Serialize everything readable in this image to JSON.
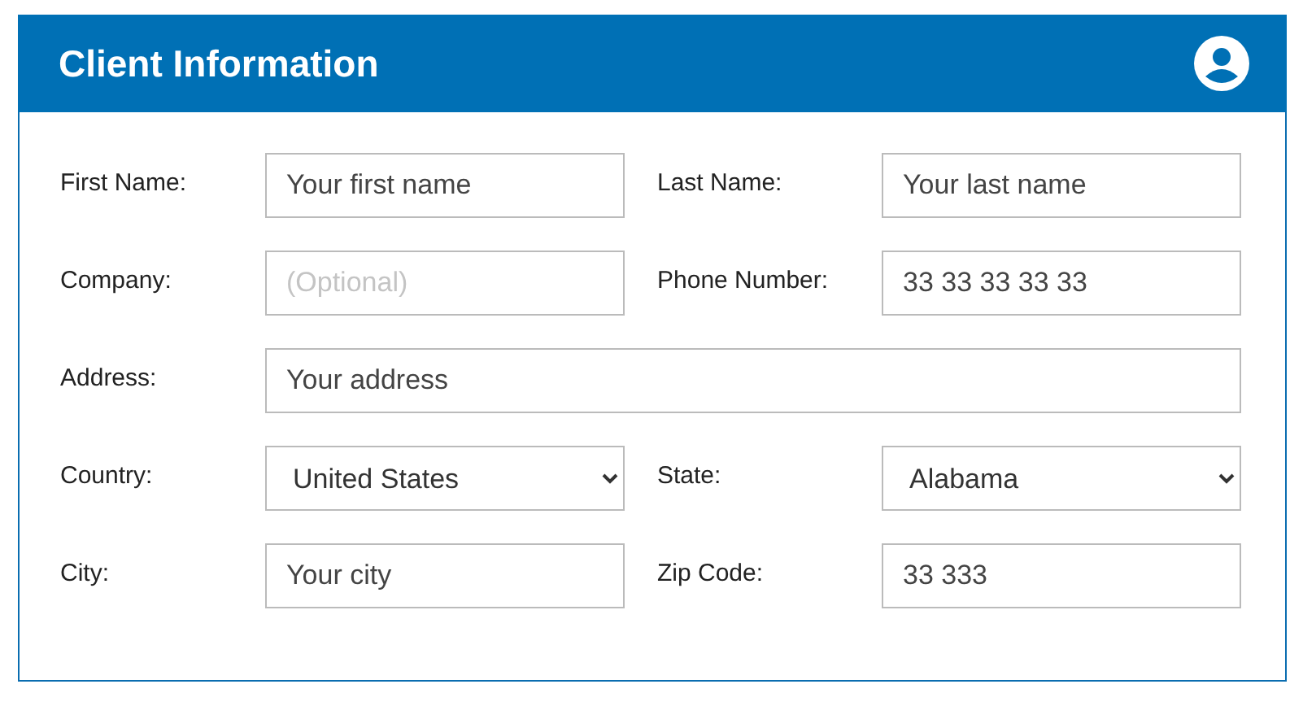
{
  "header": {
    "title": "Client Information"
  },
  "rows": [
    {
      "fields": [
        {
          "label": "First Name:",
          "kind": "text",
          "value": "Your first name"
        },
        {
          "label": "Last Name:",
          "kind": "text",
          "value": "Your last name"
        }
      ]
    },
    {
      "fields": [
        {
          "label": "Company:",
          "kind": "text",
          "placeholder": "(Optional)"
        },
        {
          "label": "Phone Number:",
          "kind": "text",
          "value": "33 33 33 33 33"
        }
      ]
    },
    {
      "fields": [
        {
          "label": "Address:",
          "kind": "text",
          "value": "Your address"
        }
      ]
    },
    {
      "fields": [
        {
          "label": "Country:",
          "kind": "select",
          "value": "United States"
        },
        {
          "label": "State:",
          "kind": "select",
          "value": "Alabama"
        }
      ]
    },
    {
      "fields": [
        {
          "label": "City:",
          "kind": "text",
          "value": "Your city"
        },
        {
          "label": "Zip Code:",
          "kind": "text",
          "value": "33 333"
        }
      ]
    }
  ]
}
